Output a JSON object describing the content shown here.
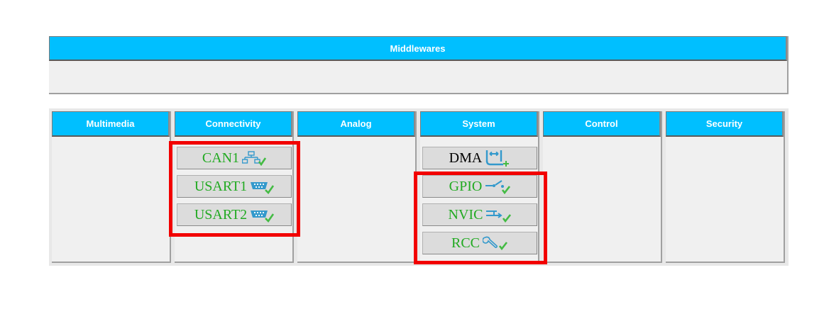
{
  "middlewares": {
    "title": "Middlewares"
  },
  "categories": [
    {
      "label": "Multimedia",
      "items": []
    },
    {
      "label": "Connectivity",
      "items": [
        {
          "label": "CAN1",
          "icon": "network-icon",
          "status": "configured"
        },
        {
          "label": "USART1",
          "icon": "serial-port-icon",
          "status": "configured"
        },
        {
          "label": "USART2",
          "icon": "serial-port-icon",
          "status": "configured"
        }
      ]
    },
    {
      "label": "Analog",
      "items": []
    },
    {
      "label": "System",
      "items": [
        {
          "label": "DMA",
          "icon": "dma-icon",
          "status": "not-configured"
        },
        {
          "label": "GPIO",
          "icon": "switch-icon",
          "status": "configured"
        },
        {
          "label": "NVIC",
          "icon": "interrupt-icon",
          "status": "configured"
        },
        {
          "label": "RCC",
          "icon": "wrench-icon",
          "status": "configured"
        }
      ]
    },
    {
      "label": "Control",
      "items": []
    },
    {
      "label": "Security",
      "items": []
    }
  ],
  "colors": {
    "header_bg": "#00bfff",
    "configured_text": "#22aa22",
    "default_text": "#000000",
    "highlight": "#f20000",
    "icon_blue": "#3399cc",
    "check_green": "#44bb44"
  }
}
